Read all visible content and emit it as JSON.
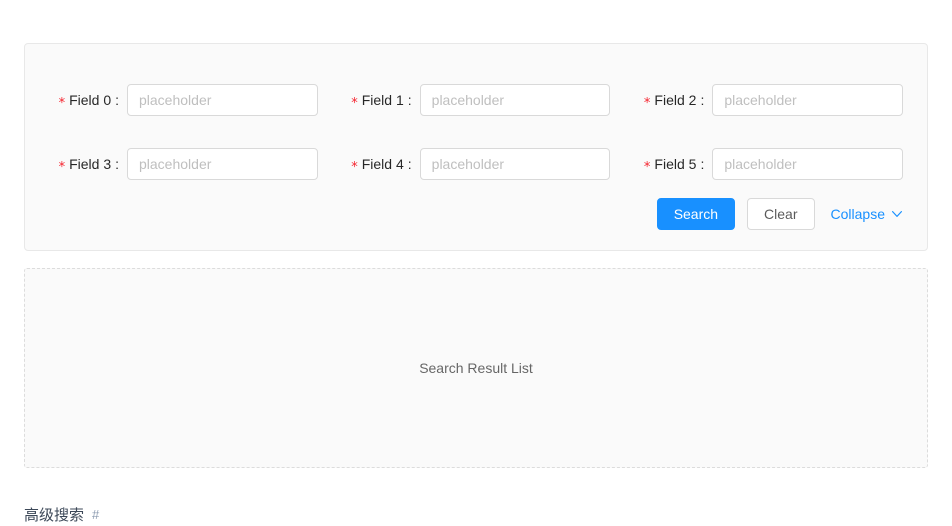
{
  "form": {
    "required_marker": "*",
    "label_colon": ":",
    "fields": [
      {
        "label": "Field 0",
        "placeholder": "placeholder",
        "value": ""
      },
      {
        "label": "Field 1",
        "placeholder": "placeholder",
        "value": ""
      },
      {
        "label": "Field 2",
        "placeholder": "placeholder",
        "value": ""
      },
      {
        "label": "Field 3",
        "placeholder": "placeholder",
        "value": ""
      },
      {
        "label": "Field 4",
        "placeholder": "placeholder",
        "value": ""
      },
      {
        "label": "Field 5",
        "placeholder": "placeholder",
        "value": ""
      }
    ]
  },
  "actions": {
    "search_label": "Search",
    "clear_label": "Clear",
    "collapse_label": "Collapse",
    "collapse_icon": "chevron-down-icon"
  },
  "result": {
    "placeholder_text": "Search Result List"
  },
  "footer": {
    "caption": "高级搜索",
    "anchor_icon": "#"
  },
  "colors": {
    "primary": "#1890ff",
    "required": "#f5222d",
    "card_bg": "#fafafa",
    "card_border": "#e8e8e8",
    "input_border": "#d9d9d9",
    "placeholder": "#bfbfbf"
  }
}
